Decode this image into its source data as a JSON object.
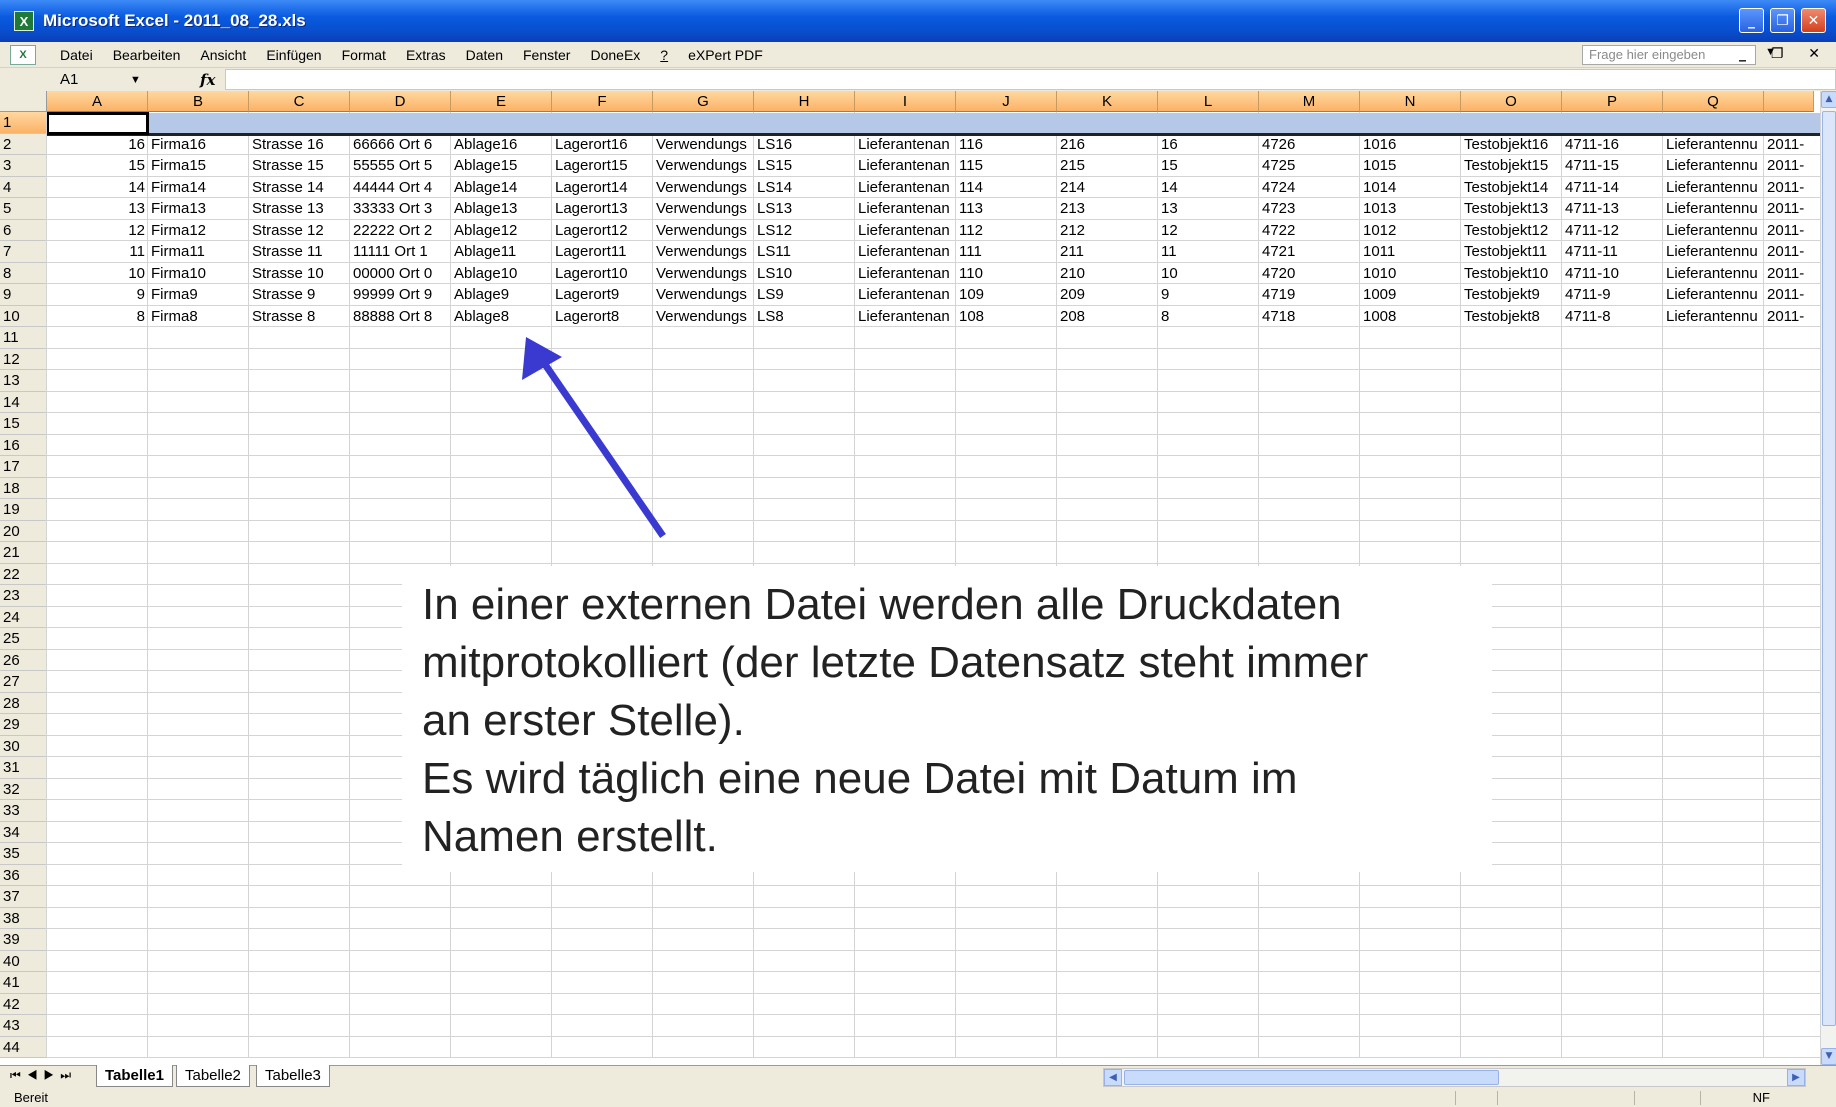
{
  "window": {
    "title": "Microsoft Excel - 2011_08_28.xls",
    "app_icon": "excel-icon",
    "controls": [
      "minimize-icon",
      "restore-icon",
      "close-icon"
    ]
  },
  "menu": {
    "items": [
      "Datei",
      "Bearbeiten",
      "Ansicht",
      "Einfügen",
      "Format",
      "Extras",
      "Daten",
      "Fenster",
      "DoneEx",
      "?",
      "eXPert PDF"
    ],
    "ask_placeholder": "Frage hier eingeben"
  },
  "formula_bar": {
    "cell_ref": "A1",
    "fx": "fx",
    "formula": ""
  },
  "sheet": {
    "columns": [
      "A",
      "B",
      "C",
      "D",
      "E",
      "F",
      "G",
      "H",
      "I",
      "J",
      "K",
      "L",
      "M",
      "N",
      "O",
      "P",
      "Q"
    ],
    "row_numbers": [
      "1",
      "2",
      "3",
      "4",
      "5",
      "6",
      "7",
      "8",
      "9",
      "10",
      "11",
      "12",
      "13",
      "14",
      "15",
      "16",
      "17",
      "18",
      "19",
      "20",
      "21",
      "22",
      "23",
      "24",
      "25",
      "26",
      "27",
      "28",
      "29",
      "30",
      "31",
      "32",
      "33",
      "34",
      "35",
      "36",
      "37",
      "38",
      "39",
      "40",
      "41",
      "42",
      "43",
      "44"
    ],
    "active_cell": "A1",
    "rows": [
      [
        "16",
        "Firma16",
        "Strasse 16",
        "66666 Ort 6",
        "Ablage16",
        "Lagerort16",
        "Verwendungs",
        "LS16",
        "Lieferantenan",
        "116",
        "216",
        "16",
        "4726",
        "1016",
        "Testobjekt16",
        "4711-16",
        "Lieferantennu",
        "2011-"
      ],
      [
        "15",
        "Firma15",
        "Strasse 15",
        "55555 Ort 5",
        "Ablage15",
        "Lagerort15",
        "Verwendungs",
        "LS15",
        "Lieferantenan",
        "115",
        "215",
        "15",
        "4725",
        "1015",
        "Testobjekt15",
        "4711-15",
        "Lieferantennu",
        "2011-"
      ],
      [
        "14",
        "Firma14",
        "Strasse 14",
        "44444 Ort 4",
        "Ablage14",
        "Lagerort14",
        "Verwendungs",
        "LS14",
        "Lieferantenan",
        "114",
        "214",
        "14",
        "4724",
        "1014",
        "Testobjekt14",
        "4711-14",
        "Lieferantennu",
        "2011-"
      ],
      [
        "13",
        "Firma13",
        "Strasse 13",
        "33333 Ort 3",
        "Ablage13",
        "Lagerort13",
        "Verwendungs",
        "LS13",
        "Lieferantenan",
        "113",
        "213",
        "13",
        "4723",
        "1013",
        "Testobjekt13",
        "4711-13",
        "Lieferantennu",
        "2011-"
      ],
      [
        "12",
        "Firma12",
        "Strasse 12",
        "22222 Ort 2",
        "Ablage12",
        "Lagerort12",
        "Verwendungs",
        "LS12",
        "Lieferantenan",
        "112",
        "212",
        "12",
        "4722",
        "1012",
        "Testobjekt12",
        "4711-12",
        "Lieferantennu",
        "2011-"
      ],
      [
        "11",
        "Firma11",
        "Strasse 11",
        "11111 Ort 1",
        "Ablage11",
        "Lagerort11",
        "Verwendungs",
        "LS11",
        "Lieferantenan",
        "111",
        "211",
        "11",
        "4721",
        "1011",
        "Testobjekt11",
        "4711-11",
        "Lieferantennu",
        "2011-"
      ],
      [
        "10",
        "Firma10",
        "Strasse 10",
        "00000 Ort 0",
        "Ablage10",
        "Lagerort10",
        "Verwendungs",
        "LS10",
        "Lieferantenan",
        "110",
        "210",
        "10",
        "4720",
        "1010",
        "Testobjekt10",
        "4711-10",
        "Lieferantennu",
        "2011-"
      ],
      [
        "9",
        "Firma9",
        "Strasse 9",
        "99999 Ort 9",
        "Ablage9",
        "Lagerort9",
        "Verwendungs",
        "LS9",
        "Lieferantenan",
        "109",
        "209",
        "9",
        "4719",
        "1009",
        "Testobjekt9",
        "4711-9",
        "Lieferantennu",
        "2011-"
      ],
      [
        "8",
        "Firma8",
        "Strasse 8",
        "88888 Ort 8",
        "Ablage8",
        "Lagerort8",
        "Verwendungs",
        "LS8",
        "Lieferantenan",
        "108",
        "208",
        "8",
        "4718",
        "1008",
        "Testobjekt8",
        "4711-8",
        "Lieferantennu",
        "2011-"
      ]
    ]
  },
  "tabs": {
    "nav_icons": [
      "first-sheet-icon",
      "prev-sheet-icon",
      "next-sheet-icon",
      "last-sheet-icon"
    ],
    "sheets": [
      "Tabelle1",
      "Tabelle2",
      "Tabelle3"
    ],
    "active": "Tabelle1"
  },
  "status": {
    "text": "Bereit",
    "nf": "NF"
  },
  "annotation": {
    "text": "In einer externen Datei werden alle Druckdaten mitprotokolliert (der letzte Datensatz steht immer an erster Stelle).\nEs wird täglich eine neue Datei mit Datum im Namen erstellt.",
    "arrow_color": "#3a3ad0"
  },
  "colors": {
    "title_bar": "#0a5ae0",
    "header_active": "#fbb266",
    "row1_fill": "#b6c8e8",
    "chrome": "#eeebdd"
  }
}
